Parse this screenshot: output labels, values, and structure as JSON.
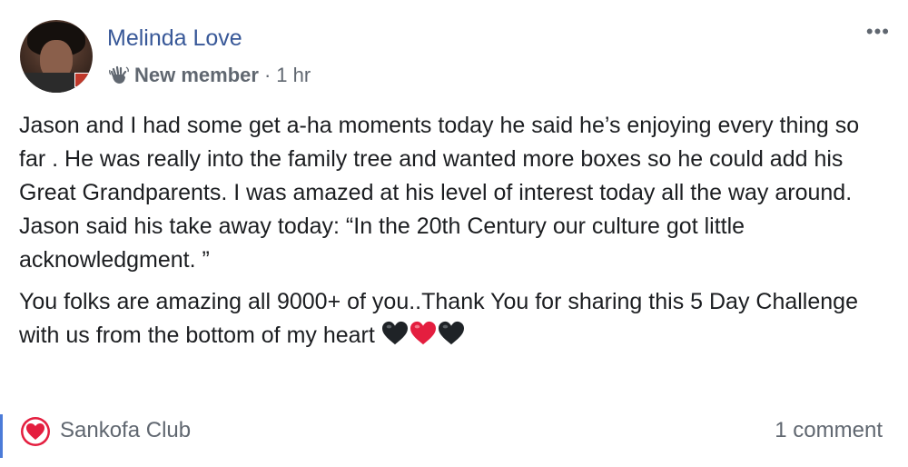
{
  "post": {
    "author": "Melinda Love",
    "badge": "New member",
    "separator": "·",
    "time": "1 hr",
    "more": "•••",
    "paragraph1_lines": [
      "Jason and I had some get a-ha moments today he said he’s enjoying every thing so far  . He was really into the family tree and wanted more boxes so he could add his Great Grandparents. I was amazed at his level of interest today all the way around.",
      "Jason said his take away today: “In the 20th Century our culture got little acknowledgment.  ”"
    ],
    "paragraph2": "You folks are amazing all 9000+ of you..Thank You for sharing this 5 Day Challenge with us from the bottom of my heart",
    "hearts": [
      "black-heart",
      "red-heart",
      "black-heart"
    ]
  },
  "footer": {
    "group_name": "Sankofa Club",
    "comments": "1 comment"
  },
  "icons": {
    "wave": "waving-hand-icon",
    "group": "heart-circle-icon"
  },
  "colors": {
    "author": "#385898",
    "meta": "#606770",
    "text": "#1c1e21",
    "accent_bar": "#4b7bd8",
    "heart_red": "#e41e3f"
  }
}
